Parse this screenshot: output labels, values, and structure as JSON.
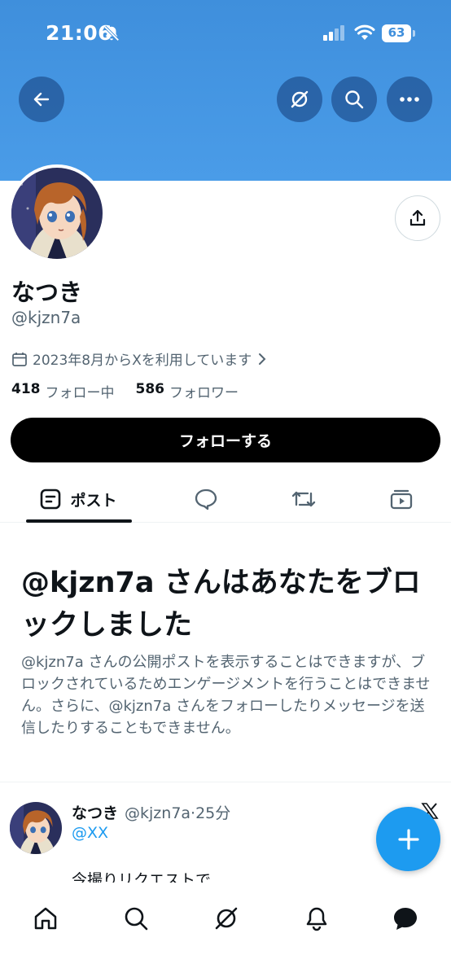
{
  "status_bar": {
    "time": "21:06",
    "battery": "63"
  },
  "profile": {
    "display_name": "なつき",
    "handle": "@kjzn7a",
    "joined": "2023年8月からXを利用しています",
    "following_count": "418",
    "following_label": "フォロー中",
    "followers_count": "586",
    "followers_label": "フォロワー",
    "follow_button": "フォローする"
  },
  "tabs": [
    {
      "label": "ポスト",
      "icon": "posts-icon",
      "active": true
    },
    {
      "label": "",
      "icon": "replies-icon"
    },
    {
      "label": "",
      "icon": "repost-icon"
    },
    {
      "label": "",
      "icon": "media-icon"
    }
  ],
  "blocked": {
    "title": "@kjzn7a さんはあなたをブロックしました",
    "description": "@kjzn7a さんの公開ポストを表示することはできますが、ブロックされているためエンゲージメントを行うことはできません。さらに、@kjzn7a さんをフォローしたりメッセージを送信したりすることもできません。"
  },
  "post": {
    "author": "なつき",
    "meta": "@kjzn7a·25分",
    "mention": "@XX",
    "text": "今撮りリクエストで"
  },
  "colors": {
    "accent": "#1d9bf0",
    "banner": "#4a9ce8"
  },
  "bottom_nav": [
    "home-icon",
    "search-icon",
    "grok-icon",
    "notifications-icon",
    "messages-icon"
  ]
}
